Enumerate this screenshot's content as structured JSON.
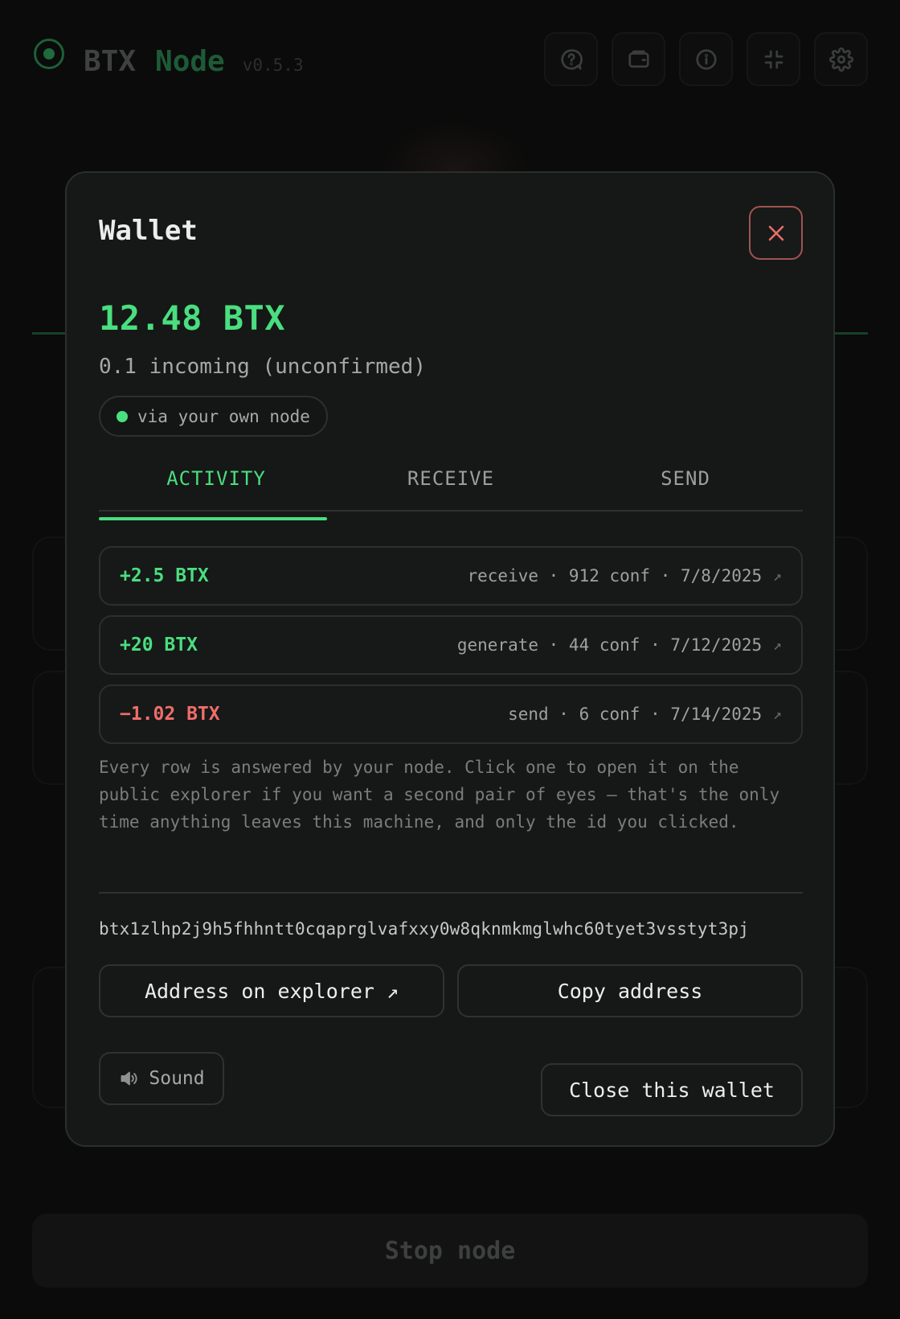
{
  "header": {
    "brand_part1": "BTX",
    "brand_part2": "Node",
    "version": "v0.5.3",
    "icons": [
      "help-chat-icon",
      "wallet-icon",
      "info-icon",
      "collapse-icon",
      "gear-icon"
    ]
  },
  "footer": {
    "stop_label": "Stop node"
  },
  "wallet": {
    "title": "Wallet",
    "balance": "12.48 BTX",
    "incoming": "0.1 incoming (unconfirmed)",
    "source_badge": "via your own node",
    "tabs": [
      {
        "label": "ACTIVITY",
        "active": true
      },
      {
        "label": "RECEIVE",
        "active": false
      },
      {
        "label": "SEND",
        "active": false
      }
    ],
    "transactions": [
      {
        "amount": "+2.5 BTX",
        "meta": "receive · 912 conf · 7/8/2025",
        "arrow": "↗",
        "direction": "in"
      },
      {
        "amount": "+20 BTX",
        "meta": "generate · 44 conf · 7/12/2025",
        "arrow": "↗",
        "direction": "in"
      },
      {
        "amount": "−1.02 BTX",
        "meta": "send · 6 conf · 7/14/2025",
        "arrow": "↗",
        "direction": "out"
      }
    ],
    "note": "Every row is answered by your node. Click one to open it on the public explorer if you want a second pair of eyes — that's the only time anything leaves this machine, and only the id you clicked.",
    "address": "btx1zlhp2j9h5fhhntt0cqaprglvafxxy0w8qknmkmglwhc60tyet3vsstyt3pj",
    "explorer_button": "Address on explorer ↗",
    "copy_button": "Copy address",
    "sound_button": "Sound",
    "close_wallet_button": "Close this wallet"
  },
  "colors": {
    "accent": "#4ade80",
    "negative": "#f06d6b",
    "modal_bg": "#151816",
    "page_bg": "#0a0b0a"
  }
}
